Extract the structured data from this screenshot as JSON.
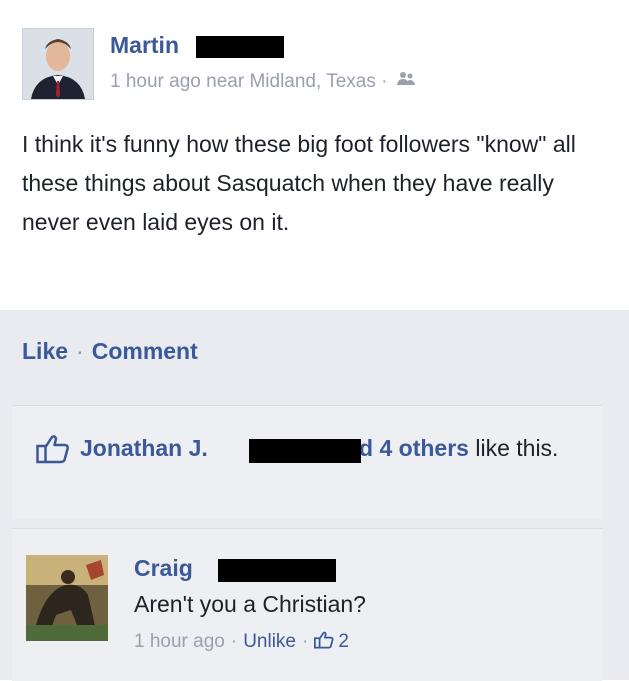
{
  "post": {
    "author": "Martin",
    "timestamp": "1 hour ago",
    "location": "near Midland, Texas",
    "separator": "·",
    "audience_icon": "friends-icon",
    "text": "I think it's funny how these big foot followers \"know\" all these things about Sasquatch when they have really never even laid eyes on it."
  },
  "actions": {
    "like_label": "Like",
    "separator": "·",
    "comment_label": "Comment"
  },
  "likes": {
    "first_liker": "Jonathan J.",
    "others_link": "and 4 others",
    "suffix": "like this."
  },
  "comment": {
    "author": "Craig",
    "text": "Aren't you a Christian?",
    "timestamp": "1 hour ago",
    "separator": "·",
    "unlike_label": "Unlike",
    "like_count": "2"
  },
  "colors": {
    "link": "#3b5998",
    "muted": "#9aa0ad",
    "feedback_bg": "#e9ebf0"
  }
}
